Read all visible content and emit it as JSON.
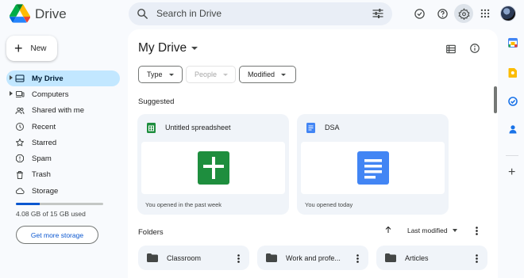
{
  "app": {
    "name": "Drive"
  },
  "search": {
    "placeholder": "Search in Drive"
  },
  "sidebar": {
    "new_label": "New",
    "items": [
      {
        "label": "My Drive",
        "icon": "my-drive-icon",
        "active": true
      },
      {
        "label": "Computers",
        "icon": "computers-icon"
      },
      {
        "label": "Shared with me",
        "icon": "people-icon"
      },
      {
        "label": "Recent",
        "icon": "clock-icon"
      },
      {
        "label": "Starred",
        "icon": "star-icon"
      },
      {
        "label": "Spam",
        "icon": "spam-icon"
      },
      {
        "label": "Trash",
        "icon": "trash-icon"
      },
      {
        "label": "Storage",
        "icon": "cloud-icon"
      }
    ],
    "storage_text": "4.08 GB of 15 GB used",
    "storage_fraction": 0.272,
    "get_storage_label": "Get more storage"
  },
  "main": {
    "title": "My Drive",
    "filters": [
      {
        "label": "Type",
        "enabled": true
      },
      {
        "label": "People",
        "enabled": false
      },
      {
        "label": "Modified",
        "enabled": true
      }
    ],
    "suggested_label": "Suggested",
    "suggested": [
      {
        "name": "Untitled spreadsheet",
        "meta": "You opened in the past week",
        "type": "sheets"
      },
      {
        "name": "DSA",
        "meta": "You opened today",
        "type": "docs"
      }
    ],
    "folders_label": "Folders",
    "sort_label": "Last modified",
    "folders": [
      {
        "name": "Classroom"
      },
      {
        "name": "Work and profe..."
      },
      {
        "name": "Articles"
      }
    ]
  },
  "colors": {
    "accent": "#0b57d0",
    "active_nav": "#c2e7ff",
    "sheets_green": "#1e8e3e",
    "docs_blue": "#4285f4"
  }
}
